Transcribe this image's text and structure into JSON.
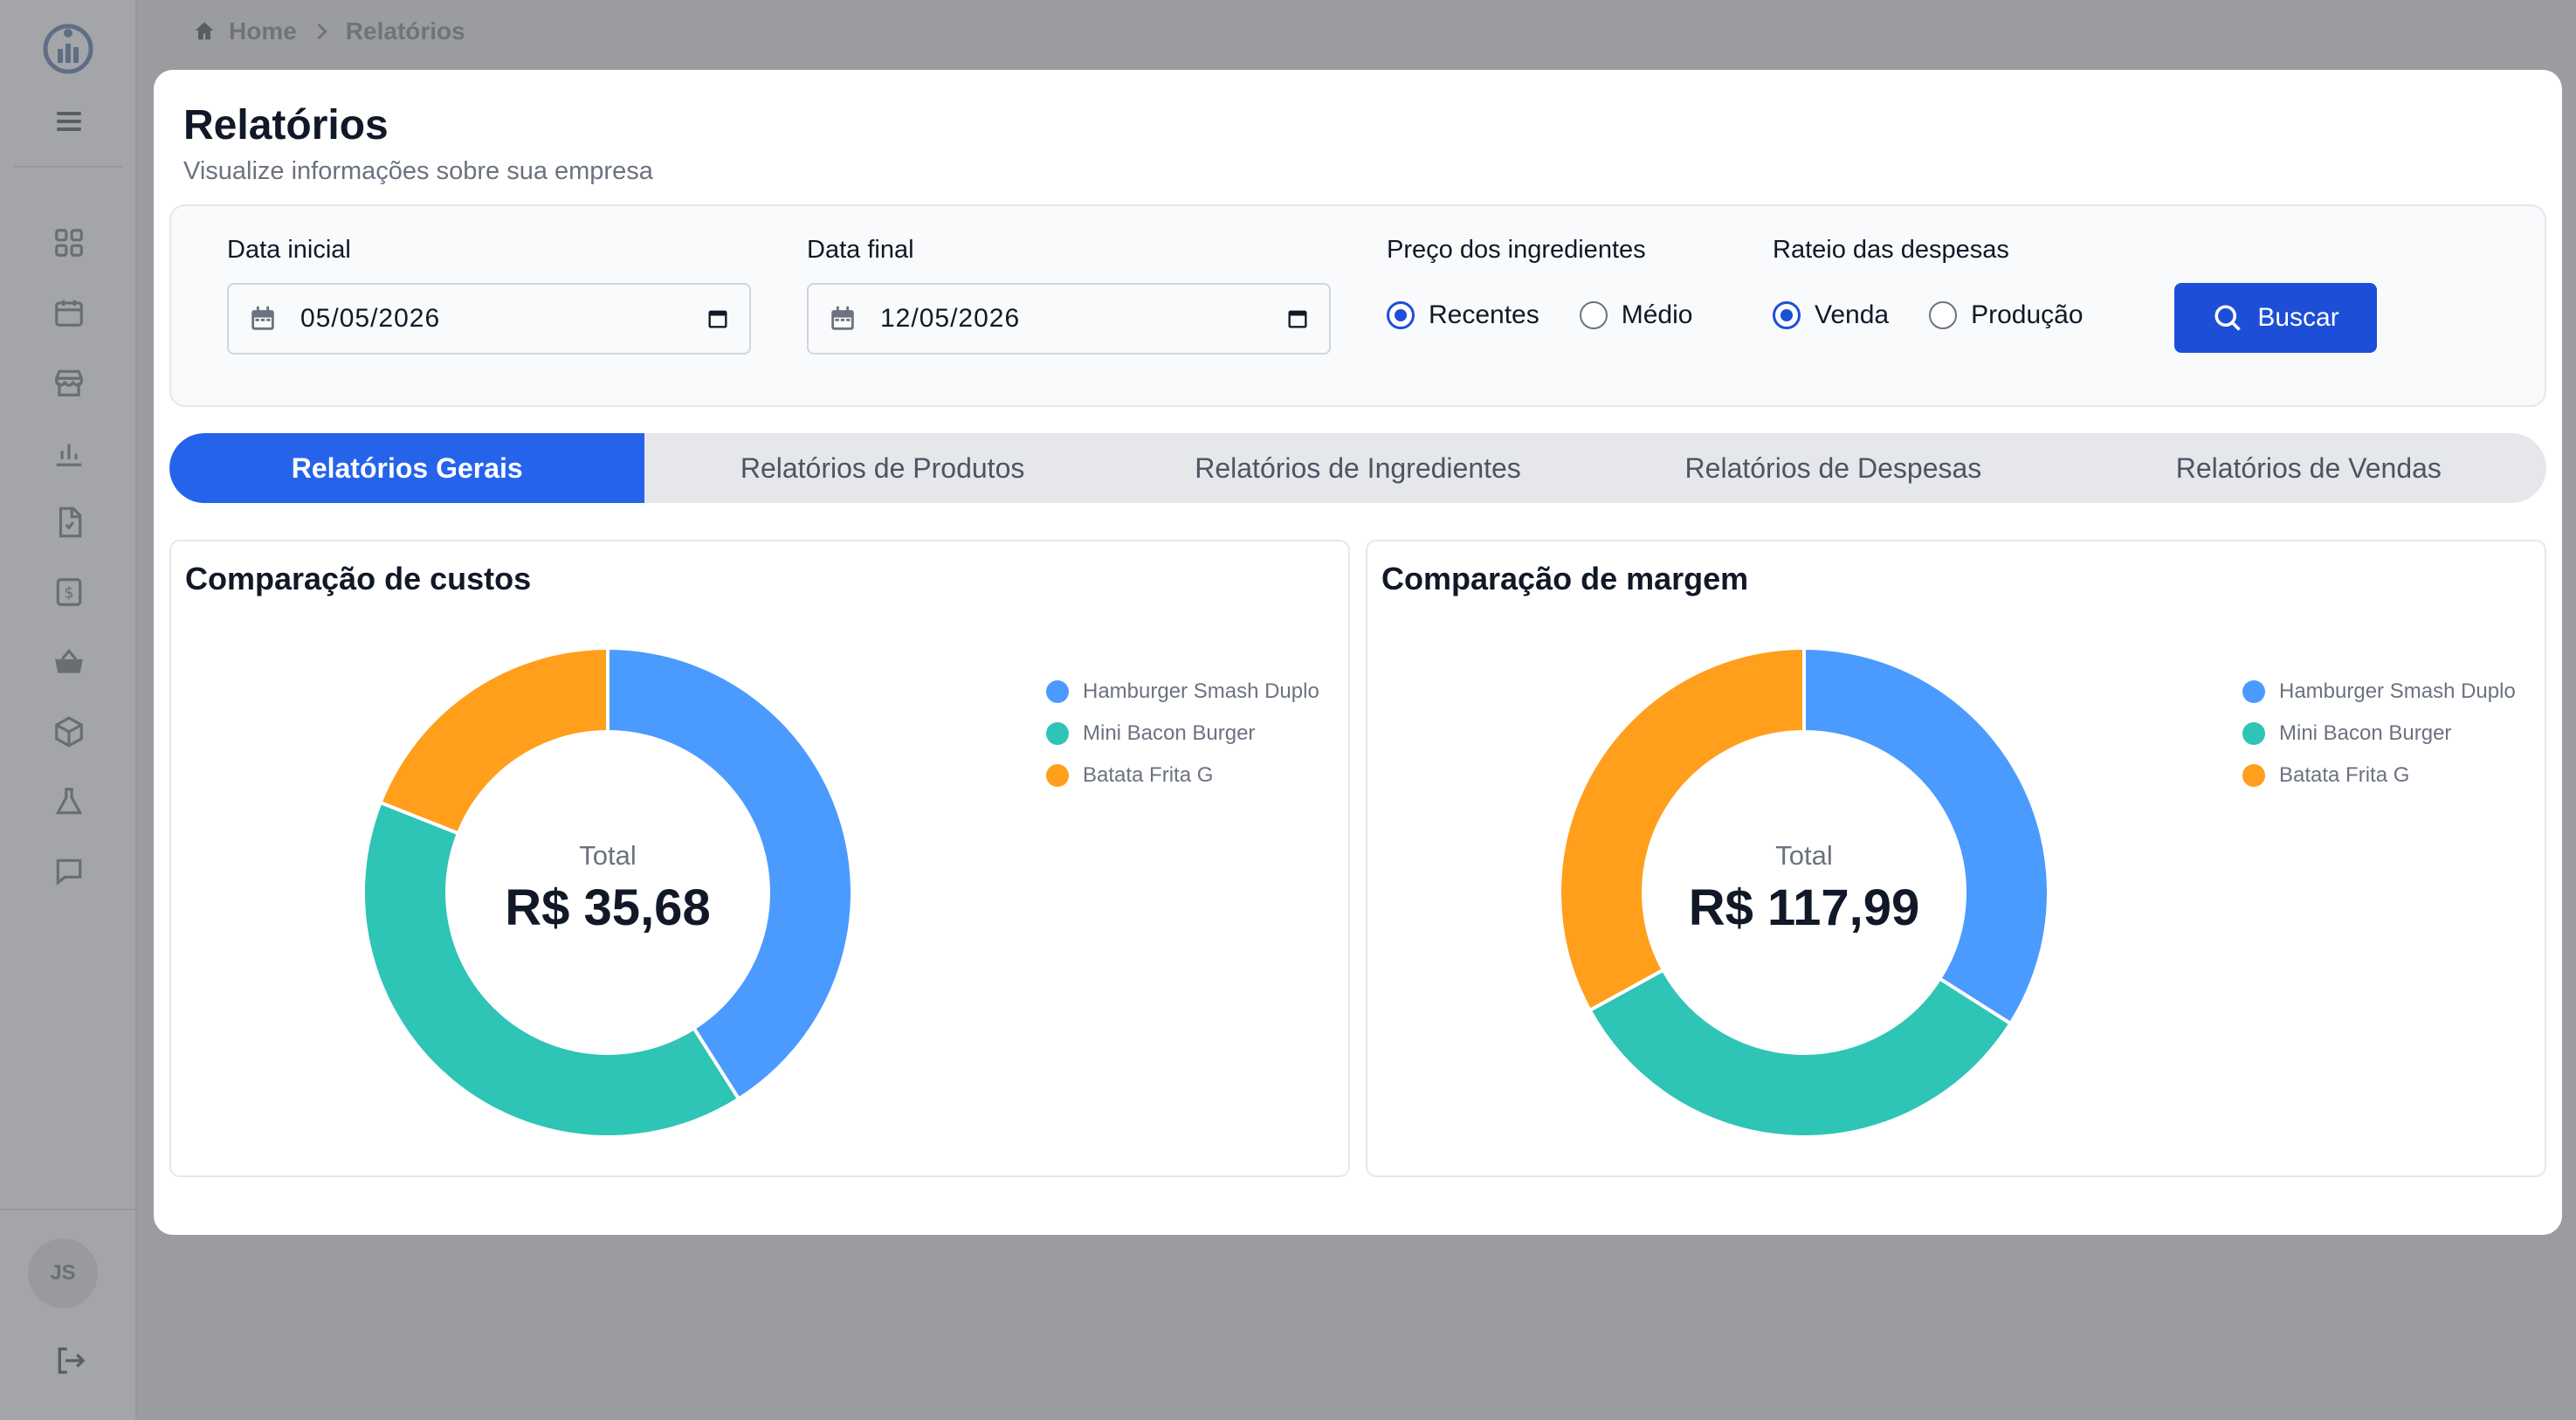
{
  "sidebar": {
    "avatar_initials": "JS"
  },
  "breadcrumb": {
    "home": "Home",
    "current": "Relatórios"
  },
  "page": {
    "title": "Relatórios",
    "subtitle": "Visualize informações sobre sua empresa"
  },
  "filters": {
    "start_label": "Data inicial",
    "start_value": "05/05/2026",
    "end_label": "Data final",
    "end_value": "12/05/2026",
    "price_label": "Preço dos ingredientes",
    "price_options": [
      {
        "label": "Recentes",
        "selected": true
      },
      {
        "label": "Médio",
        "selected": false
      }
    ],
    "expense_label": "Rateio das despesas",
    "expense_options": [
      {
        "label": "Venda",
        "selected": true
      },
      {
        "label": "Produção",
        "selected": false
      }
    ],
    "search_label": "Buscar"
  },
  "tabs": [
    {
      "label": "Relatórios Gerais",
      "active": true
    },
    {
      "label": "Relatórios de Produtos",
      "active": false
    },
    {
      "label": "Relatórios de Ingredientes",
      "active": false
    },
    {
      "label": "Relatórios de Despesas",
      "active": false
    },
    {
      "label": "Relatórios de Vendas",
      "active": false
    }
  ],
  "colors": {
    "primary": "#1d4ed8",
    "tab_active": "#2563eb",
    "series_blue": "#4b9bff",
    "series_teal": "#2ec4b6",
    "series_orange": "#ff9f1c"
  },
  "chart_data": [
    {
      "type": "pie",
      "title": "Comparação de custos",
      "center_label": "Total",
      "center_value": "R$ 35,68",
      "categories": [
        "Hamburger Smash Duplo",
        "Mini Bacon Burger",
        "Batata Frita G"
      ],
      "values": [
        41,
        40,
        19
      ],
      "colors": [
        "#4b9bff",
        "#2ec4b6",
        "#ff9f1c"
      ],
      "legend": "top-right"
    },
    {
      "type": "pie",
      "title": "Comparação de margem",
      "center_label": "Total",
      "center_value": "R$ 117,99",
      "categories": [
        "Hamburger Smash Duplo",
        "Mini Bacon Burger",
        "Batata Frita G"
      ],
      "values": [
        34,
        33,
        33
      ],
      "colors": [
        "#4b9bff",
        "#2ec4b6",
        "#ff9f1c"
      ],
      "legend": "top-right"
    }
  ]
}
